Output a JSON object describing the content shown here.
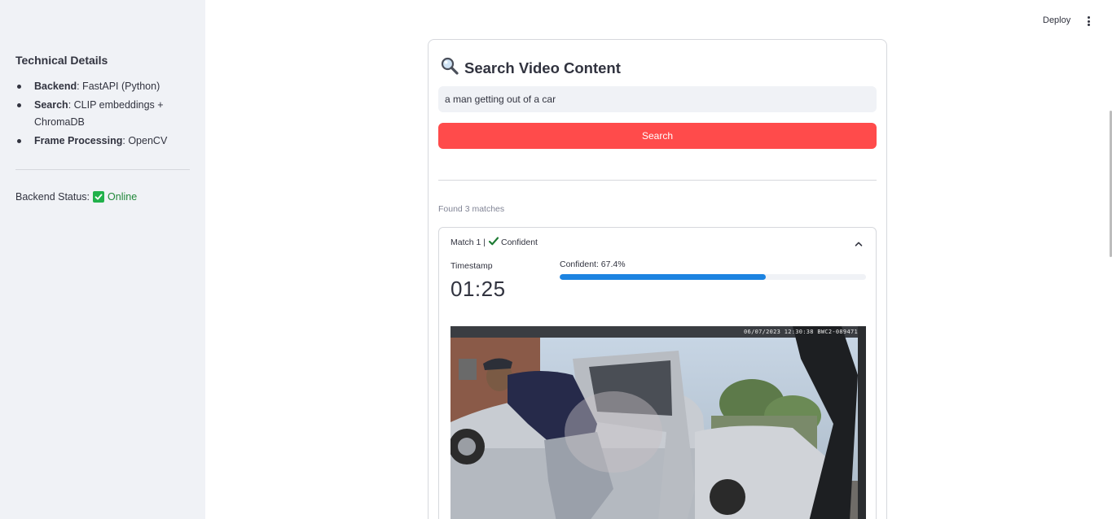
{
  "sidebar": {
    "title": "Technical Details",
    "details": [
      {
        "key": "Backend",
        "value": ": FastAPI (Python)"
      },
      {
        "key": "Search",
        "value": ": CLIP embeddings + ChromaDB"
      },
      {
        "key": "Frame Processing",
        "value": ": OpenCV"
      }
    ],
    "status_label": "Backend Status:",
    "status_value": "Online",
    "status_color": "#21b14b"
  },
  "header": {
    "deploy_label": "Deploy",
    "menu_icon": "kebab-menu-icon"
  },
  "search": {
    "title": "Search Video Content",
    "title_icon": "magnifier-icon",
    "query": "a man getting out of a car",
    "button_label": "Search",
    "button_color": "#ff4b4b"
  },
  "results": {
    "found_text": "Found 3 matches",
    "matches": [
      {
        "header_prefix": "Match 1 |",
        "header_status": "Confident",
        "timestamp_label": "Timestamp",
        "timestamp": "01:25",
        "confidence_label": "Confident: 67.4%",
        "confidence": 0.674,
        "frame_stamp": "06/07/2023 12:30:38 BWC2-089471"
      }
    ]
  },
  "accent_color": "#1c83e1"
}
